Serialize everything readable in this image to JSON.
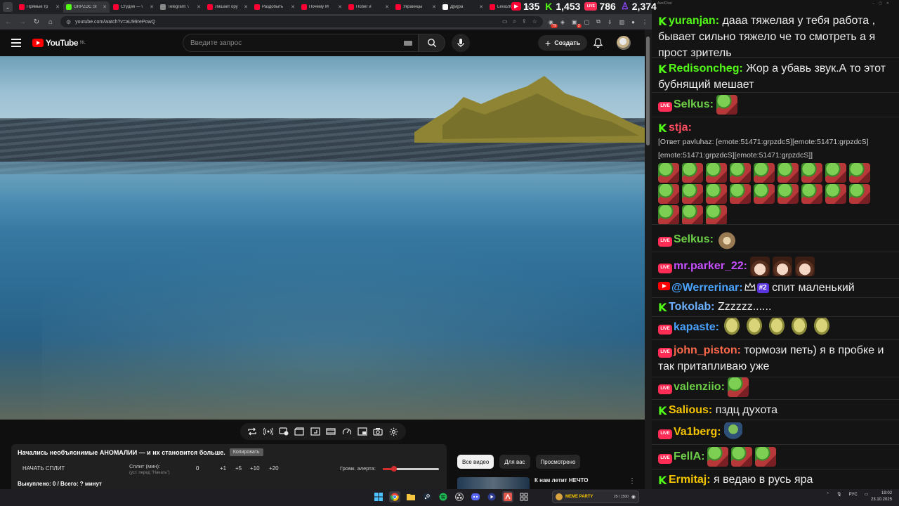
{
  "browser": {
    "tabs": [
      {
        "label": "Прямые тр",
        "color": "#ff0033"
      },
      {
        "label": "GRPZDC St",
        "color": "#53fc18",
        "active": true
      },
      {
        "label": "Студия — \\",
        "color": "#ff0033"
      },
      {
        "label": "Telegram: \\",
        "color": "#8a8a8a"
      },
      {
        "label": "Лишает ору",
        "color": "#ff0033"
      },
      {
        "label": "Раздобыть",
        "color": "#ff0033"
      },
      {
        "label": "Почему М",
        "color": "#ff0033"
      },
      {
        "label": "Побег и",
        "color": "#ff0033"
      },
      {
        "label": "Украинцы",
        "color": "#ff0033"
      },
      {
        "label": "Д[м]ра",
        "color": "#ffffff"
      },
      {
        "label": "Leva2K //",
        "color": "#ff0033"
      }
    ],
    "url": "youtube.com/watch?v=aU99rePowQ",
    "ext_badge_1": "79",
    "ext_badge_2": "2"
  },
  "counters": [
    {
      "platform": "youtube",
      "value": "135",
      "color": "#ff0033"
    },
    {
      "platform": "kick",
      "value": "1,453",
      "color": "#53fc18"
    },
    {
      "platform": "vk-live",
      "value": "786",
      "color": "#ff2d55"
    },
    {
      "platform": "twitch",
      "value": "2,374",
      "color": "#9147ff"
    }
  ],
  "youtube": {
    "logo_text": "YouTube",
    "region": "NL",
    "search_placeholder": "Введите запрос",
    "create_label": "Создать"
  },
  "split": {
    "title": "Начались необъяснимые АНОМАЛИИ — и их становится больше.",
    "copy_label": "Копировать",
    "start_label": "НАЧАТЬ СПЛИТ",
    "split_label": "Сплит (мин):",
    "split_hint": "(уст. перед \"Начать\")",
    "split_value": "0",
    "increments": [
      "+1",
      "+5",
      "+10",
      "+20"
    ],
    "alert_label": "Громк. алерта:",
    "alert_volume": 0.2,
    "footer": "Выкуплено: 0 / Всего: ? минут"
  },
  "recs": {
    "chips": [
      {
        "label": "Все видео",
        "active": true
      },
      {
        "label": "Для вас",
        "active": false
      },
      {
        "label": "Просмотрено",
        "active": false
      }
    ],
    "first_title": "К нам летит НЕЧТО"
  },
  "chat": {
    "window_title": "AxelChat",
    "messages": [
      {
        "platform": "kick",
        "user": "yuranjan:",
        "color": "#53fc18",
        "text": "дааа тяжелая у тебя работа , бывает сильно тяжело че то смотреть а я прост зритель"
      },
      {
        "platform": "kick",
        "user": "Redisoncheg:",
        "color": "#53fc18",
        "text": "Жор а убавь звук.А то этот бубнящий мешает"
      },
      {
        "platform": "live",
        "user": "Selkus:",
        "color": "#6ccf47",
        "emotes": "grp",
        "count": 1
      },
      {
        "platform": "kick",
        "user": "stja:",
        "color": "#ff4d5e",
        "reply": "[Ответ pavluhaz: [emote:51471:grpzdcS][emote:51471:grpzdcS][emote:51471:grpzdcS][emote:51471:grpzdcS]]",
        "emotes": "grp",
        "count": 21
      },
      {
        "platform": "live",
        "user": "Selkus:",
        "color": "#6ccf47",
        "emotes": "rat",
        "count": 1
      },
      {
        "platform": "live",
        "user": "mr.parker_22:",
        "color": "#c64fff",
        "emotes": "anime",
        "count": 3
      },
      {
        "platform": "youtube",
        "user": "@Werrerinar:",
        "color": "#4aa3ff",
        "rank": "#2",
        "text": "спит маленький"
      },
      {
        "platform": "kick",
        "user": "Tokolab:",
        "color": "#6ab0ff",
        "text": "Zzzzzz......"
      },
      {
        "platform": "live",
        "user": "kapaste:",
        "color": "#4aa3ff",
        "emotes": "blob",
        "count": 5
      },
      {
        "platform": "live",
        "user": "john_piston:",
        "color": "#ff6a4d",
        "text": "тормози петь) я в пробке и так притапливаю уже"
      },
      {
        "platform": "live",
        "user": "valenziio:",
        "color": "#6ccf47",
        "emotes": "grp",
        "count": 1
      },
      {
        "platform": "kick",
        "user": "Salious:",
        "color": "#f5c400",
        "text": "пздц духота"
      },
      {
        "platform": "live",
        "user": "Va1berg:",
        "color": "#f5c400",
        "emotes": "frog",
        "count": 1
      },
      {
        "platform": "live",
        "user": "FellA:",
        "color": "#6ccf47",
        "emotes": "grp",
        "count": 3
      },
      {
        "platform": "kick",
        "user": "Ermitaj:",
        "color": "#f5c400",
        "text": "я ведаю в русь яра"
      }
    ]
  },
  "taskbar": {
    "widget_name": "MEME PARTY",
    "widget_value": "25 / 1500",
    "lang": "РУС",
    "time": "19:02",
    "date": "23.10.2025"
  }
}
